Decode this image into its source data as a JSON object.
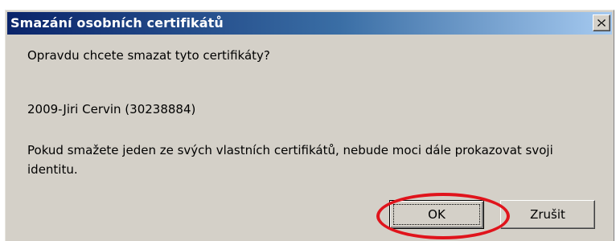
{
  "dialog": {
    "title": "Smazání osobních certifikátů",
    "close_label": "×",
    "question": "Opravdu chcete smazat tyto certifikáty?",
    "certificate": "2009-Jiri Cervin (30238884)",
    "warning": "Pokud smažete jeden ze svých vlastních certifikátů, nebude moci dále prokazovat svoji identitu.",
    "ok_label": "OK",
    "cancel_label": "Zrušit"
  },
  "colors": {
    "title_gradient_start": "#0a246a",
    "title_gradient_end": "#a6caf0",
    "dialog_bg": "#d4d0c8",
    "highlight_circle": "#e0141c"
  },
  "icons": {
    "close": "close-icon"
  }
}
